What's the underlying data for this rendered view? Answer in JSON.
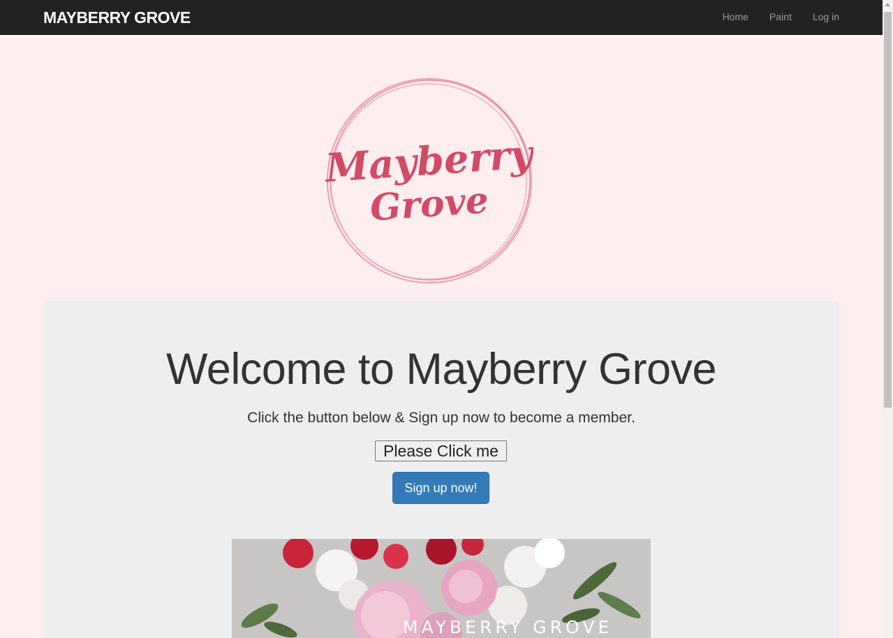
{
  "navbar": {
    "brand": "MAYBERRY GROVE",
    "links": [
      "Home",
      "Paint",
      "Log in"
    ]
  },
  "logo": {
    "line1": "Mayberry",
    "line2": "Grove"
  },
  "jumbotron": {
    "heading": "Welcome to Mayberry Grove",
    "subtitle": "Click the button below & Sign up now to become a member.",
    "click_button": "Please Click me",
    "signup_button": "Sign up now!"
  },
  "banner": {
    "text": "MAYBERRY GROVE"
  },
  "colors": {
    "page_background": "#ffeeef",
    "navbar": "#222222",
    "logo_accent": "#d14a66",
    "primary_button": "#337ab7"
  }
}
